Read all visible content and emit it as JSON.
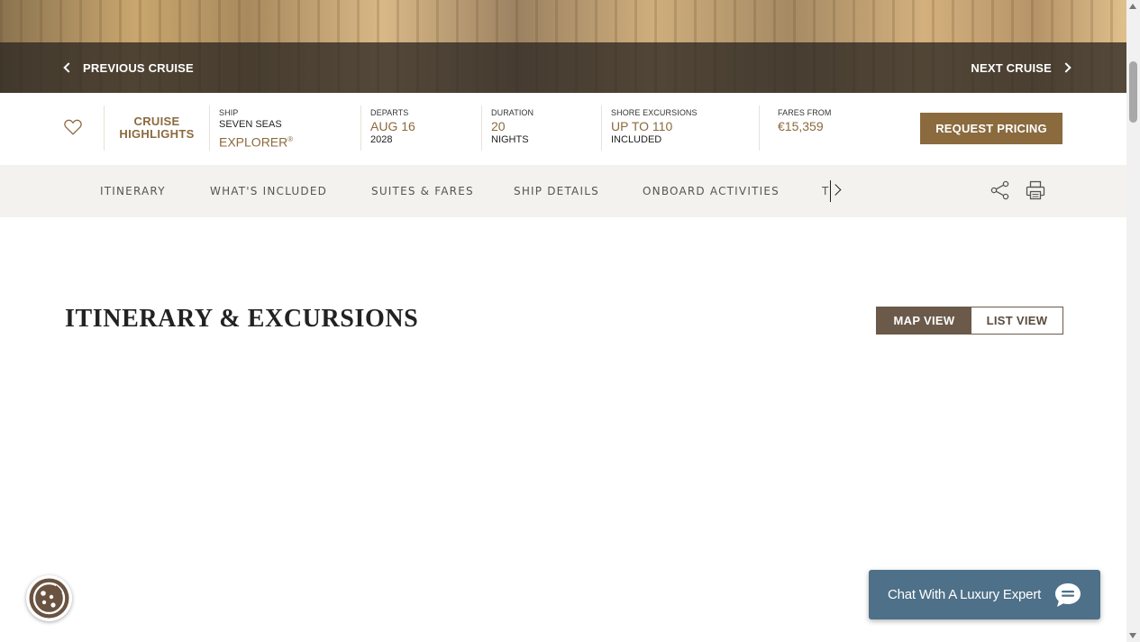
{
  "hero": {
    "prev_label": "PREVIOUS CRUISE",
    "next_label": "NEXT CRUISE"
  },
  "cruise": {
    "highlights_line1": "CRUISE",
    "highlights_line2": "HIGHLIGHTS",
    "ship_label": "SHIP",
    "ship_line1": "SEVEN SEAS",
    "ship_line2": "EXPLORER",
    "ship_mark": "®",
    "departs_label": "DEPARTS",
    "departs_value": "AUG 16",
    "departs_year": "2028",
    "duration_label": "DURATION",
    "duration_value": "20",
    "duration_unit": "NIGHTS",
    "shore_label": "SHORE EXCURSIONS",
    "shore_value": "UP TO 110",
    "shore_sub": "INCLUDED",
    "fares_label": "FARES FROM",
    "fares_value": "€15,359",
    "request_label": "REQUEST PRICING"
  },
  "tabs": [
    {
      "label": "ITINERARY"
    },
    {
      "label": "WHAT'S INCLUDED"
    },
    {
      "label": "SUITES & FARES"
    },
    {
      "label": "SHIP DETAILS"
    },
    {
      "label": "ONBOARD ACTIVITIES"
    },
    {
      "label": "T"
    }
  ],
  "main": {
    "title": "ITINERARY & EXCURSIONS",
    "map_view_label": "MAP VIEW",
    "list_view_label": "LIST VIEW"
  },
  "chat": {
    "label": "Chat With A Luxury Expert"
  },
  "icons": {
    "heart": "heart-icon",
    "share": "share-icon",
    "print": "print-icon",
    "cookie": "cookie-icon",
    "chat": "chat-bubble-icon"
  },
  "colors": {
    "accent_gold": "#8b6a3e",
    "toggle_brown": "#6b5a4a",
    "tab_bar_bg": "#f4f2ee",
    "chat_blue": "#4e7088"
  }
}
